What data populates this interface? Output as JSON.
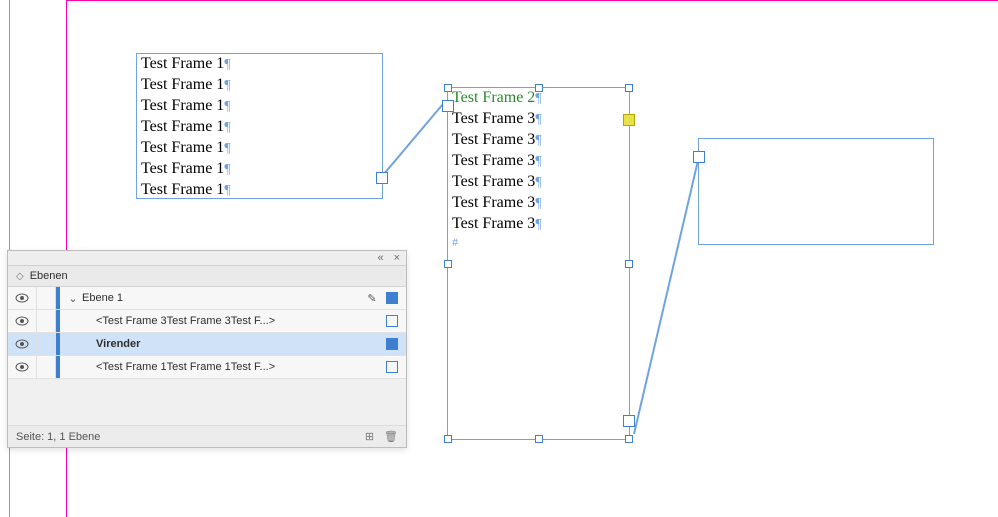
{
  "frames": {
    "f1": {
      "lines": [
        "Test Frame 1",
        "Test Frame 1",
        "Test Frame 1",
        "Test Frame 1",
        "Test Frame 1",
        "Test Frame 1",
        "Test Frame 1"
      ]
    },
    "f2": {
      "first": "Test Frame 2",
      "rest": [
        "Test Frame 3",
        "Test Frame 3",
        "Test Frame 3",
        "Test Frame 3",
        "Test Frame 3",
        "Test Frame 3"
      ]
    }
  },
  "panel": {
    "title": "Ebenen",
    "layer": "Ebene 1",
    "items": [
      "<Test Frame 3Test Frame 3Test F...>",
      "Virender",
      "<Test Frame 1Test Frame 1Test F...>"
    ],
    "footer": "Seite: 1, 1 Ebene"
  },
  "glyphs": {
    "pilcrow": "¶",
    "hash": "#",
    "chevrons": "«",
    "close": "×",
    "updown": "◇",
    "down": "⌄",
    "pen": "✎",
    "newlayer": "⊞",
    "trash": "🗑",
    "eye": "●"
  }
}
